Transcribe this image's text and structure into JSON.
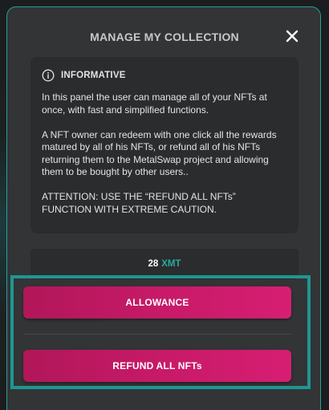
{
  "modal": {
    "title": "MANAGE MY COLLECTION",
    "close_icon": "close-icon"
  },
  "info": {
    "icon": "info-icon",
    "title": "INFORMATIVE",
    "paragraph1": "In this panel the user can manage all of your NFTs at once, with fast and simplified functions.",
    "paragraph2": "A NFT owner can redeem with one click all the rewards matured by all of his NFTs, or refund all of his NFTs returning them to the MetalSwap project and allowing them to be bought by other users..",
    "paragraph3": "ATTENTION: USE THE “REFUND ALL NFTs” FUNCTION WITH EXTREME CAUTION."
  },
  "balance": {
    "value": "28",
    "unit": "XMT"
  },
  "actions": {
    "allowance_label": "ALLOWANCE",
    "refund_label": "REFUND ALL NFTs"
  },
  "colors": {
    "accent_teal": "#1f9692",
    "button_magenta": "#c91a69",
    "panel": "#323436"
  }
}
